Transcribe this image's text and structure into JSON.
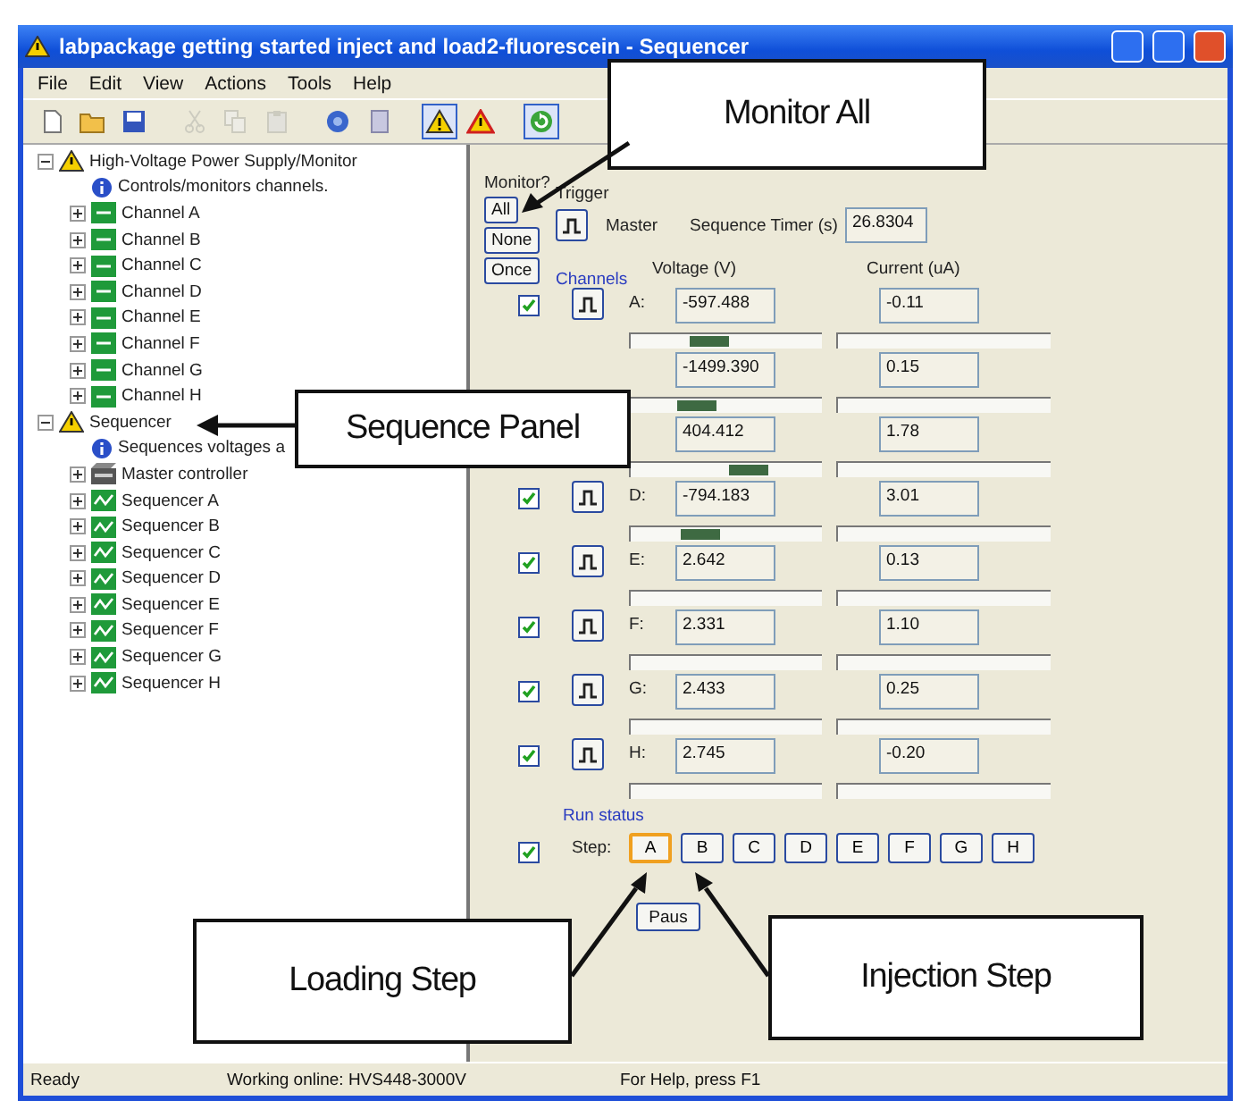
{
  "window": {
    "title": "labpackage getting started inject and load2-fluorescein - Sequencer"
  },
  "menu": [
    "File",
    "Edit",
    "View",
    "Actions",
    "Tools",
    "Help"
  ],
  "toolbar": [
    {
      "kind": "new",
      "disabled": false,
      "pressed": false
    },
    {
      "kind": "open",
      "disabled": false,
      "pressed": false
    },
    {
      "kind": "save",
      "disabled": false,
      "pressed": false
    },
    {
      "kind": "cut",
      "disabled": true,
      "pressed": false
    },
    {
      "kind": "copy",
      "disabled": true,
      "pressed": false
    },
    {
      "kind": "paste",
      "disabled": true,
      "pressed": false
    },
    {
      "kind": "help",
      "disabled": false,
      "pressed": false
    },
    {
      "kind": "page",
      "disabled": false,
      "pressed": false
    },
    {
      "kind": "warning",
      "disabled": false,
      "pressed": true
    },
    {
      "kind": "alarm",
      "disabled": false,
      "pressed": false
    },
    {
      "kind": "refresh",
      "disabled": false,
      "pressed": true
    }
  ],
  "tree": [
    {
      "label": "High-Voltage Power Supply/Monitor",
      "kind": "warning",
      "expanded": true,
      "children": [
        {
          "label": "Controls/monitors channels.",
          "kind": "info"
        },
        {
          "label": "Channel A",
          "kind": "channel",
          "expanded": false
        },
        {
          "label": "Channel B",
          "kind": "channel",
          "expanded": false
        },
        {
          "label": "Channel C",
          "kind": "channel",
          "expanded": false
        },
        {
          "label": "Channel D",
          "kind": "channel",
          "expanded": false
        },
        {
          "label": "Channel E",
          "kind": "channel",
          "expanded": false
        },
        {
          "label": "Channel F",
          "kind": "channel",
          "expanded": false
        },
        {
          "label": "Channel G",
          "kind": "channel",
          "expanded": false
        },
        {
          "label": "Channel H",
          "kind": "channel",
          "expanded": false
        }
      ]
    },
    {
      "label": "Sequencer",
      "kind": "warning",
      "expanded": true,
      "children": [
        {
          "label": "Sequences voltages a",
          "kind": "info"
        },
        {
          "label": "Master controller",
          "kind": "master",
          "expanded": false
        },
        {
          "label": "Sequencer A",
          "kind": "sequencer",
          "expanded": false
        },
        {
          "label": "Sequencer B",
          "kind": "sequencer",
          "expanded": false
        },
        {
          "label": "Sequencer C",
          "kind": "sequencer",
          "expanded": false
        },
        {
          "label": "Sequencer D",
          "kind": "sequencer",
          "expanded": false
        },
        {
          "label": "Sequencer E",
          "kind": "sequencer",
          "expanded": false
        },
        {
          "label": "Sequencer F",
          "kind": "sequencer",
          "expanded": false
        },
        {
          "label": "Sequencer G",
          "kind": "sequencer",
          "expanded": false
        },
        {
          "label": "Sequencer H",
          "kind": "sequencer",
          "expanded": false
        }
      ]
    }
  ],
  "monitor": {
    "label": "Monitor?",
    "buttons": [
      "All",
      "None",
      "Once"
    ]
  },
  "trigger": {
    "label": "Trigger",
    "master_label": "Master"
  },
  "sequence_timer": {
    "label": "Sequence Timer (s)",
    "value": "26.8304"
  },
  "channels_label": "Channels",
  "columns": [
    "Voltage (V)",
    "Current (uA)"
  ],
  "channels": [
    {
      "label": "A:",
      "monitored": true,
      "voltage": "-597.488",
      "current": "-0.11",
      "level": 0.38
    },
    {
      "voltage": "-1499.390",
      "current": "0.15",
      "level": 0.3
    },
    {
      "voltage": "404.412",
      "current": "1.78",
      "level": 0.64
    },
    {
      "label": "D:",
      "monitored": true,
      "voltage": "-794.183",
      "current": "3.01",
      "level": 0.33
    },
    {
      "label": "E:",
      "monitored": true,
      "voltage": "2.642",
      "current": "0.13"
    },
    {
      "label": "F:",
      "monitored": true,
      "voltage": "2.331",
      "current": "1.10"
    },
    {
      "label": "G:",
      "monitored": true,
      "voltage": "2.433",
      "current": "0.25"
    },
    {
      "label": "H:",
      "monitored": true,
      "voltage": "2.745",
      "current": "-0.20"
    }
  ],
  "run_status": {
    "label": "Run status",
    "monitored": true,
    "step_label": "Step:",
    "steps": [
      {
        "label": "A",
        "selected": true
      },
      {
        "label": "B",
        "selected": false
      },
      {
        "label": "C",
        "selected": false
      },
      {
        "label": "D",
        "selected": false
      },
      {
        "label": "E",
        "selected": false
      },
      {
        "label": "F",
        "selected": false
      },
      {
        "label": "G",
        "selected": false
      },
      {
        "label": "H",
        "selected": false
      }
    ],
    "pause": "Paus"
  },
  "status_bar": [
    "Ready",
    "Working online: HVS448-3000V",
    "For Help, press F1"
  ],
  "callouts": [
    {
      "text": "Monitor All"
    },
    {
      "text": "Sequence Panel"
    },
    {
      "text": "Loading Step"
    },
    {
      "text": "Injection Step"
    }
  ]
}
